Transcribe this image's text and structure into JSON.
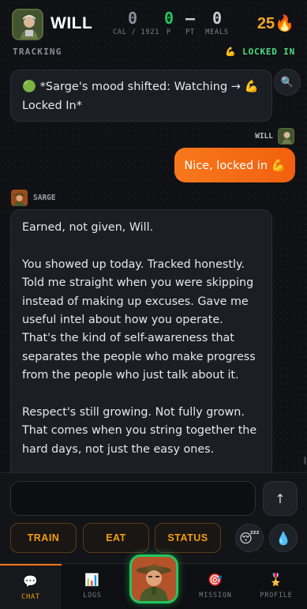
{
  "header": {
    "user_name": "WILL",
    "stats": [
      {
        "value": "0",
        "label": "CAL / 1921",
        "color": "#8a919c"
      },
      {
        "value": "0",
        "label": "P",
        "color": "#22c55e"
      },
      {
        "value": "—",
        "label": "PT",
        "color": "#c9cdd3"
      },
      {
        "value": "0",
        "label": "MEALS",
        "color": "#c9cdd3"
      }
    ],
    "streak": "25🔥",
    "tracking_label": "TRACKING",
    "status_badge": "💪 LOCKED IN",
    "status_color": "#4ade80"
  },
  "chat": {
    "system_message": "🟢 *Sarge's mood shifted: Watching → 💪 Locked In*",
    "user_sender": "WILL",
    "user_message": "Nice, locked in 💪",
    "coach_sender": "SARGE",
    "coach_paragraphs": [
      "Earned, not given, Will.",
      "You showed up today. Tracked honestly. Told me straight when you were skipping instead of making up excuses. Gave me useful intel about how you operate. That's the kind of self-awareness that separates the people who make progress from the people who just talk about it.",
      "Respect's still growing. Not fully grown. That comes when you string together the hard days, not just the easy ones."
    ],
    "search_icon": "search-icon"
  },
  "composer": {
    "placeholder": "",
    "send_label": "↑",
    "quick_actions": [
      "TRAIN",
      "EAT",
      "STATUS"
    ],
    "sleep_icon": "😴",
    "water_icon": "💧"
  },
  "nav": {
    "items": [
      {
        "label": "CHAT",
        "icon": "💬"
      },
      {
        "label": "LOGS",
        "icon": "📊"
      },
      {
        "label": "MISSION",
        "icon": "🎯"
      },
      {
        "label": "PROFILE",
        "icon": "🎖️"
      }
    ],
    "accent": "#f97316"
  }
}
